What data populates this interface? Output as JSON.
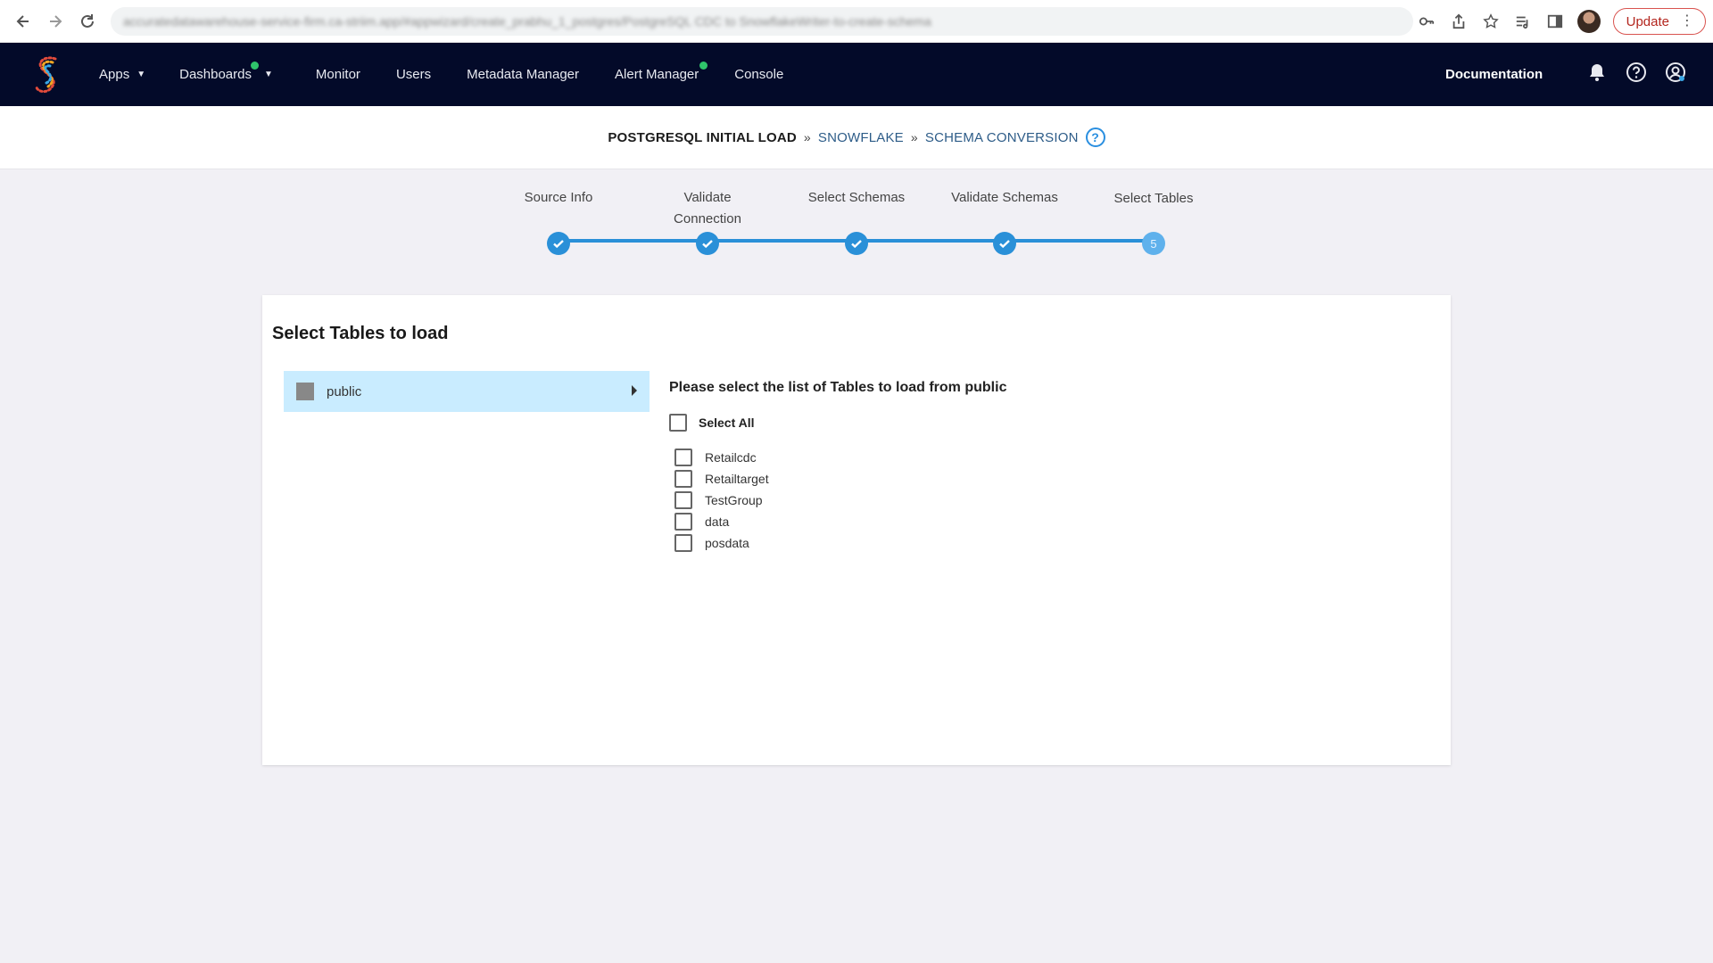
{
  "browser": {
    "url": "accuratedatawarehouse-service-firm.ca-striim.app/#appwizard/create_prabhu_1_postgres/PostgreSQL CDC to SnowflakeWriter-to-create-schema",
    "update_label": "Update"
  },
  "header": {
    "nav": [
      {
        "label": "Apps",
        "has_caret": true,
        "has_dot": false
      },
      {
        "label": "Dashboards",
        "has_caret": true,
        "has_dot": true
      },
      {
        "label": "Monitor",
        "has_caret": false,
        "has_dot": false
      },
      {
        "label": "Users",
        "has_caret": false,
        "has_dot": false
      },
      {
        "label": "Metadata Manager",
        "has_caret": false,
        "has_dot": false
      },
      {
        "label": "Alert Manager",
        "has_caret": false,
        "has_dot": true
      },
      {
        "label": "Console",
        "has_caret": false,
        "has_dot": false
      }
    ],
    "documentation_label": "Documentation"
  },
  "breadcrumb": {
    "items": [
      "POSTGRESQL INITIAL LOAD",
      "SNOWFLAKE",
      "SCHEMA CONVERSION"
    ],
    "help_glyph": "?"
  },
  "stepper": {
    "steps": [
      {
        "label": "Source Info",
        "label_line2": "",
        "status": "complete"
      },
      {
        "label": "Validate",
        "label_line2": "Connection",
        "status": "complete"
      },
      {
        "label": "Select Schemas",
        "label_line2": "",
        "status": "complete"
      },
      {
        "label": "Validate Schemas",
        "label_line2": "",
        "status": "complete"
      },
      {
        "label": "Select Tables",
        "label_line2": "",
        "status": "current",
        "number": "5"
      }
    ]
  },
  "main": {
    "title": "Select Tables to load",
    "schema": {
      "label": "public"
    },
    "prompt": "Please select the list of Tables to load from public",
    "select_all_label": "Select All",
    "tables": [
      {
        "label": "Retailcdc",
        "checked": false
      },
      {
        "label": "Retailtarget",
        "checked": false
      },
      {
        "label": "TestGroup",
        "checked": false
      },
      {
        "label": "data",
        "checked": false
      },
      {
        "label": "posdata",
        "checked": false
      }
    ]
  },
  "colors": {
    "header_bg": "#030a29",
    "accent": "#2a90d8",
    "schema_selected_bg": "#c9ecff",
    "status_dot": "#2fc46b"
  }
}
